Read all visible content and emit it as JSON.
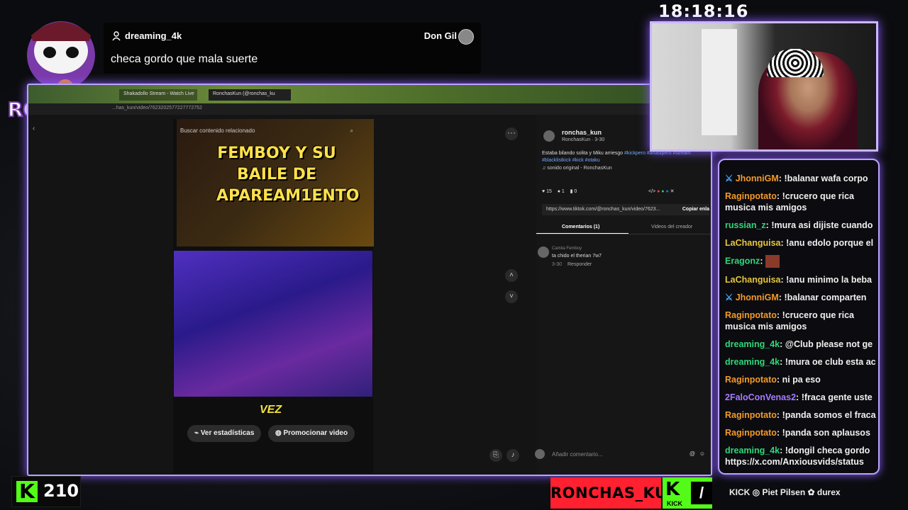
{
  "clock": "18:18:16",
  "notification": {
    "user": "dreaming_4k",
    "target": "Don Gil",
    "message": "checa gordo que mala suerte"
  },
  "logo": {
    "text": "RONCHAS"
  },
  "browser": {
    "tabs": [
      {
        "label": "Shakadollo Stream - Watch Live"
      },
      {
        "label": "RonchasKun (@ronchas_ku"
      }
    ],
    "url": "...has_kun/video/7623202577227772752"
  },
  "tiktok": {
    "search_placeholder": "Buscar contenido relacionado",
    "thumbnail_title": "FEMBOY Y SU BAILE DE APAREAM1ENTO",
    "video_caption": "VEZ",
    "buttons": {
      "stats": "Ver estadísticas",
      "promote": "Promocionar video"
    },
    "author": {
      "handle": "ronchas_kun",
      "sub": "RonchasKun · 3-30"
    },
    "description_text": "Estaba bilando solita y Miku arriesgo ",
    "description_tags": "#kickpero #ahasipero #stream #blacklistkick #kick #otaku",
    "sound": "sonido original - RonchasKun",
    "stats": {
      "likes": "15",
      "comments": "1",
      "saves": "0"
    },
    "link": "https://www.tiktok.com/@ronchas_kun/video/7623...",
    "copy_link": "Copiar enla",
    "tab_comments": "Comentarios (1)",
    "tab_creator": "Videos del creador",
    "comment": {
      "author": "Camila Femboy",
      "text": "ta chido el therian 7w7",
      "date": "3-30",
      "reply": "Responder"
    },
    "comment_placeholder": "Añadir comentario..."
  },
  "chat": [
    {
      "user": "JhonniGM",
      "color": "u-orange",
      "sword": true,
      "text": "!balanar wafa corpo"
    },
    {
      "user": "Raginpotato",
      "color": "u-orange",
      "text": "!crucero que rica musica mis amigos",
      "wrap": true
    },
    {
      "user": "russian_z",
      "color": "u-green",
      "text": "!mura asi dijiste cuando"
    },
    {
      "user": "LaChanguisa",
      "color": "u-yellow",
      "text": "!anu edolo porque el"
    },
    {
      "user": "Eragonz",
      "color": "u-green",
      "text": "",
      "emote": true
    },
    {
      "user": "LaChanguisa",
      "color": "u-yellow",
      "text": "!anu minimo la beba"
    },
    {
      "user": "JhonniGM",
      "color": "u-orange",
      "sword": true,
      "text": "!balanar comparten"
    },
    {
      "user": "Raginpotato",
      "color": "u-orange",
      "text": "!crucero que rica musica mis amigos",
      "wrap": true
    },
    {
      "user": "dreaming_4k",
      "color": "u-green",
      "text": "@Club please not ge"
    },
    {
      "user": "dreaming_4k",
      "color": "u-green",
      "text": "!mura oe club esta ac"
    },
    {
      "user": "Raginpotato",
      "color": "u-orange",
      "text": "ni pa eso"
    },
    {
      "user": "2FaloConVenas2",
      "color": "u-purple",
      "text": "!fraca gente uste"
    },
    {
      "user": "Raginpotato",
      "color": "u-orange",
      "text": "!panda somos el fraca"
    },
    {
      "user": "Raginpotato",
      "color": "u-orange",
      "text": "!panda son aplausos"
    },
    {
      "user": "dreaming_4k",
      "color": "u-green",
      "text": "!dongil checa gordo https://x.com/Anxiousvids/status",
      "wrap": true
    }
  ],
  "followers": "210",
  "channel_name": "RONCHAS_KUN",
  "kick_badge": {
    "k": "K",
    "label": "KICK"
  },
  "sponsors": "KICK  ◎  Piet  Pilsen  ✿  durex",
  "colors": {
    "accent": "#b9a3ff",
    "kick_green": "#53fc18",
    "name_red": "#ff2030"
  }
}
